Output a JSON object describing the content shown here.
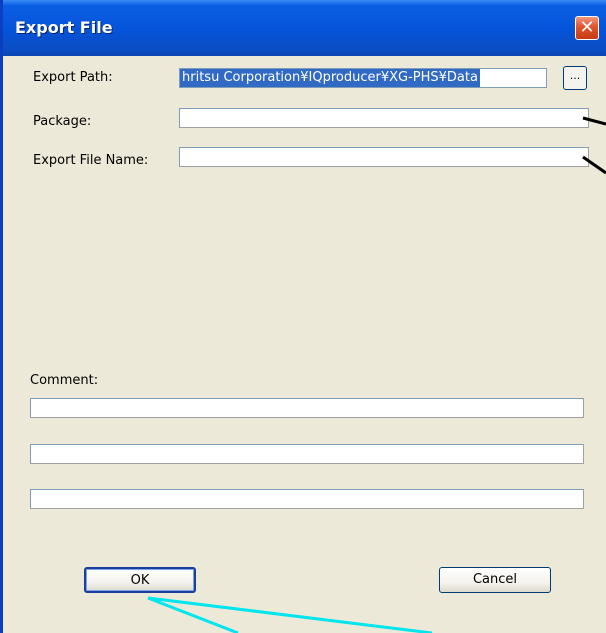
{
  "window": {
    "title": "Export File",
    "close_glyph": "✕"
  },
  "form": {
    "export_path_label": "Export Path:",
    "export_path_value": "hritsu Corporation¥IQproducer¥XG-PHS¥Data",
    "browse_label": "...",
    "package_label": "Package:",
    "package_value": "",
    "export_file_name_label": "Export File Name:",
    "export_file_name_value": "",
    "comment_label": "Comment:",
    "comment_lines": [
      "",
      "",
      ""
    ]
  },
  "buttons": {
    "ok_label": "OK",
    "cancel_label": "Cancel"
  },
  "colors": {
    "title_bar": "#0553d8",
    "dialog_face": "#ece9d8",
    "close_button": "#e0542d",
    "selection_highlight": "#316ac5",
    "annotation_cyan": "#00e5ee",
    "annotation_black": "#000000"
  }
}
